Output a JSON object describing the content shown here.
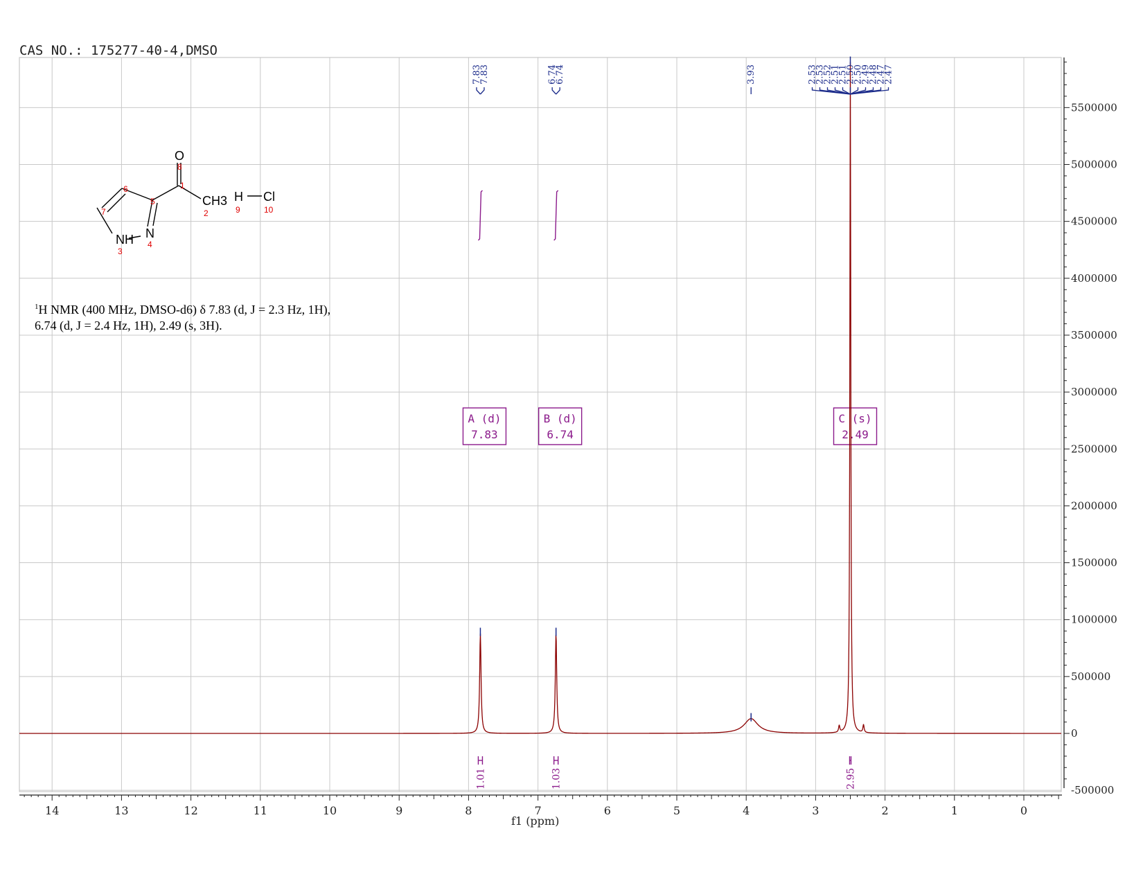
{
  "header": {
    "title": "CAS NO.: 175277-40-4,DMSO"
  },
  "description": {
    "line1_pre": "1",
    "line1": "H NMR (400 MHz, DMSO-d6) δ 7.83 (d, J = 2.3 Hz, 1H),",
    "line2": "6.74 (d, J = 2.4 Hz, 1H), 2.49 (s, 3H)."
  },
  "structure": {
    "atoms": [
      "O",
      "CH3",
      "H",
      "Cl",
      "NH",
      "N"
    ],
    "atom_numbers": [
      "1",
      "2",
      "3",
      "4",
      "5",
      "6",
      "7",
      "8",
      "9",
      "10"
    ]
  },
  "chart_data": {
    "type": "line",
    "xlabel": "f1 (ppm)",
    "ylabel": "",
    "xlim": [
      14.5,
      -0.5
    ],
    "ylim": [
      -500000,
      5900000
    ],
    "x_ticks": [
      14,
      13,
      12,
      11,
      10,
      9,
      8,
      7,
      6,
      5,
      4,
      3,
      2,
      1,
      0
    ],
    "y_ticks": [
      -500000,
      0,
      500000,
      1000000,
      1500000,
      2000000,
      2500000,
      3000000,
      3500000,
      4000000,
      4500000,
      5000000,
      5500000
    ],
    "y_tick_labels": [
      "-500000",
      "0",
      "500000",
      "1000000",
      "1500000",
      "2000000",
      "2500000",
      "3000000",
      "3500000",
      "4000000",
      "4500000",
      "5000000",
      "5500000"
    ],
    "grid": true,
    "peaks": [
      {
        "ppm": 7.83,
        "height": 880000,
        "width": 0.012,
        "shape": "sharp"
      },
      {
        "ppm": 6.74,
        "height": 880000,
        "width": 0.012,
        "shape": "sharp"
      },
      {
        "ppm": 3.93,
        "height": 130000,
        "width": 0.12,
        "shape": "broad"
      },
      {
        "ppm": 2.5,
        "height": 5900000,
        "width": 0.008,
        "shape": "sharp"
      },
      {
        "ppm": 2.66,
        "height": 60000,
        "width": 0.01,
        "shape": "sharp"
      },
      {
        "ppm": 2.31,
        "height": 70000,
        "width": 0.01,
        "shape": "sharp"
      }
    ],
    "peak_labels": [
      {
        "group": "A",
        "values": [
          "7.83",
          "7.83"
        ],
        "ppm": 7.83
      },
      {
        "group": "B",
        "values": [
          "6.74",
          "6.74"
        ],
        "ppm": 6.74
      },
      {
        "group": "C",
        "values": [
          "3.93"
        ],
        "ppm": 3.93
      },
      {
        "group": "D",
        "values": [
          "2.53",
          "2.53",
          "2.52",
          "2.51",
          "2.51",
          "2.50",
          "2.50",
          "2.49",
          "2.48",
          "2.47",
          "2.47"
        ],
        "ppm": 2.5
      }
    ],
    "multiplets": [
      {
        "label": "A (d)",
        "value": "7.83",
        "ppm": 7.83
      },
      {
        "label": "B (d)",
        "value": "6.74",
        "ppm": 6.74
      },
      {
        "label": "C (s)",
        "value": "2.49",
        "ppm": 2.49
      }
    ],
    "integrals": [
      {
        "value": "1.01",
        "ppm": 7.83,
        "range": [
          7.89,
          7.77
        ]
      },
      {
        "value": "1.03",
        "ppm": 6.74,
        "range": [
          6.8,
          6.68
        ]
      },
      {
        "value": "2.95",
        "ppm": 2.5,
        "range": [
          2.52,
          2.48
        ]
      }
    ],
    "colors": {
      "spectrum": "#8b0000",
      "peak_label": "#1a2a8a",
      "integral": "#8b1a8b",
      "grid": "#c8c8c8"
    }
  }
}
